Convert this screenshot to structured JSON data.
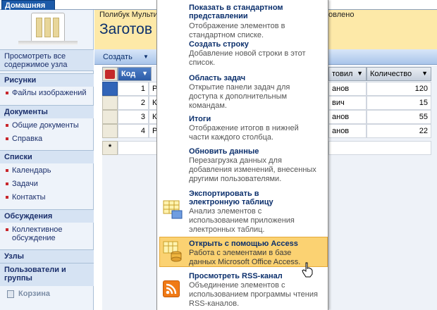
{
  "tabs": {
    "home": "Домашняя"
  },
  "header": {
    "breadcrumb": "Полибук Мульти",
    "breadcrumb_right": "овлено",
    "title": "Заготов"
  },
  "toolbar": {
    "create_label": "Создать"
  },
  "nav": {
    "view_all": "Просмотреть все содержимое узла",
    "sections": [
      {
        "label": "Рисунки",
        "items": [
          "Файлы изображений"
        ]
      },
      {
        "label": "Документы",
        "items": [
          "Общие документы",
          "Справка"
        ]
      },
      {
        "label": "Списки",
        "items": [
          "Календарь",
          "Задачи",
          "Контакты"
        ]
      },
      {
        "label": "Обсуждения",
        "items": [
          "Коллективное обсуждение"
        ]
      },
      {
        "label": "Узлы",
        "items": []
      },
      {
        "label": "Пользователи и группы",
        "items": []
      }
    ],
    "recycle_bin": "Корзина"
  },
  "grid": {
    "columns": [
      "Код",
      "товил",
      "Количество"
    ],
    "rows": [
      {
        "id": "1",
        "name_start": "Р",
        "supplier_end": "анов",
        "qty": "120"
      },
      {
        "id": "2",
        "name_start": "К",
        "supplier_end": "вич",
        "qty": "15"
      },
      {
        "id": "3",
        "name_start": "К",
        "supplier_end": "анов",
        "qty": "55"
      },
      {
        "id": "4",
        "name_start": "Р",
        "supplier_end": "анов",
        "qty": "22"
      }
    ],
    "new_row_marker": "*"
  },
  "menu": {
    "items": [
      {
        "title": "Показать в стандартном представлении",
        "desc": "Отображение элементов в стандартном списке.",
        "icon": "standard-view-icon"
      },
      {
        "title": "Создать строку",
        "desc": "Добавление новой строки в этот список.",
        "icon": "new-row-icon"
      },
      {
        "title": "Область задач",
        "desc": "Открытие панели задач для доступа к дополнительным командам.",
        "icon": "task-pane-icon"
      },
      {
        "title": "Итоги",
        "desc": "Отображение итогов в нижней части каждого столбца.",
        "icon": "totals-icon"
      },
      {
        "title": "Обновить данные",
        "desc": "Перезагрузка данных для добавления изменений, внесенных другими пользователями.",
        "icon": "refresh-icon"
      },
      {
        "title": "Экспортировать в электронную таблицу",
        "desc": "Анализ элементов с использованием приложения электронных таблиц.",
        "icon": "spreadsheet-export-icon"
      },
      {
        "title": "Открыть с помощью Access",
        "desc": "Работа с элементами в базе данных Microsoft Office Access.",
        "icon": "access-icon"
      },
      {
        "title": "Просмотреть RSS-канал",
        "desc": "Объединение элементов с использованием программы чтения RSS-каналов.",
        "icon": "rss-icon"
      }
    ]
  },
  "colors": {
    "title_band": "#fde9a8",
    "menu_highlight": "#fbd272",
    "nav_link": "#1b2f6b",
    "accent_red": "#c8262c"
  }
}
